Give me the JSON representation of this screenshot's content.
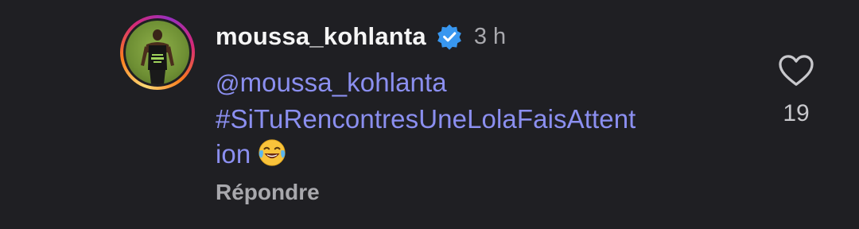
{
  "comment": {
    "username": "moussa_kohlanta",
    "time": "3 h",
    "mention_glyph": "@",
    "mention_text": "moussa_kohlanta",
    "hashtag_part1": "#SiTuRencontresUneLolaFaisAttent",
    "hashtag_part2": "ion",
    "emoji": "face-with-tears-of-joy",
    "reply_label": "Répondre",
    "like_count": "19",
    "verified": true
  },
  "colors": {
    "background": "#1f1f23",
    "username": "#f5f5f5",
    "link": "#8b8ff0",
    "muted": "#a8a8ad",
    "verified_badge": "#3897f0"
  },
  "icons": {
    "avatar": "profile-photo",
    "badge": "verified-badge-icon",
    "like": "heart-outline-icon",
    "threads": "threads-logo-icon"
  }
}
